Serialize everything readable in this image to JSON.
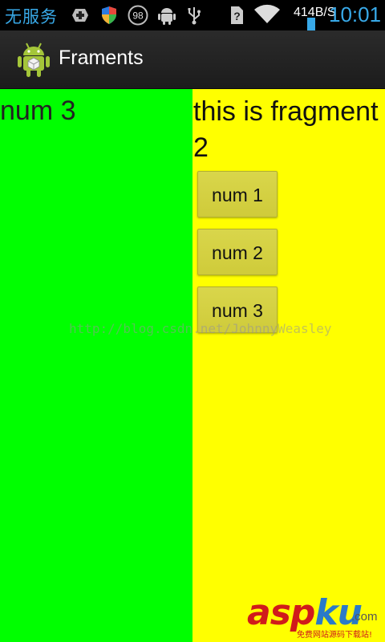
{
  "status_bar": {
    "carrier": "无服务",
    "speed": "414B/S",
    "time": "10:01",
    "badge_number": "98",
    "icons": [
      "plus-box-icon",
      "shield-icon",
      "badge-98-icon",
      "android-icon",
      "usb-icon",
      "no-sim-icon",
      "wifi-icon",
      "battery-icon"
    ]
  },
  "action_bar": {
    "title": "Framents",
    "icon": "android-app-icon"
  },
  "fragment1": {
    "text": "num 3",
    "color": "#00ff00"
  },
  "fragment2": {
    "title": "this is fragment 2",
    "color": "#ffff00",
    "buttons": [
      {
        "label": "num 1"
      },
      {
        "label": "num 2"
      },
      {
        "label": "num 3"
      }
    ]
  },
  "watermark": {
    "url": "http://blog.csdn.net/JohnnyWeasley",
    "logo_part1": "asp",
    "logo_part2": "ku",
    "logo_dotcom": ".com",
    "logo_tagline": "免费网站源码下载站!"
  }
}
